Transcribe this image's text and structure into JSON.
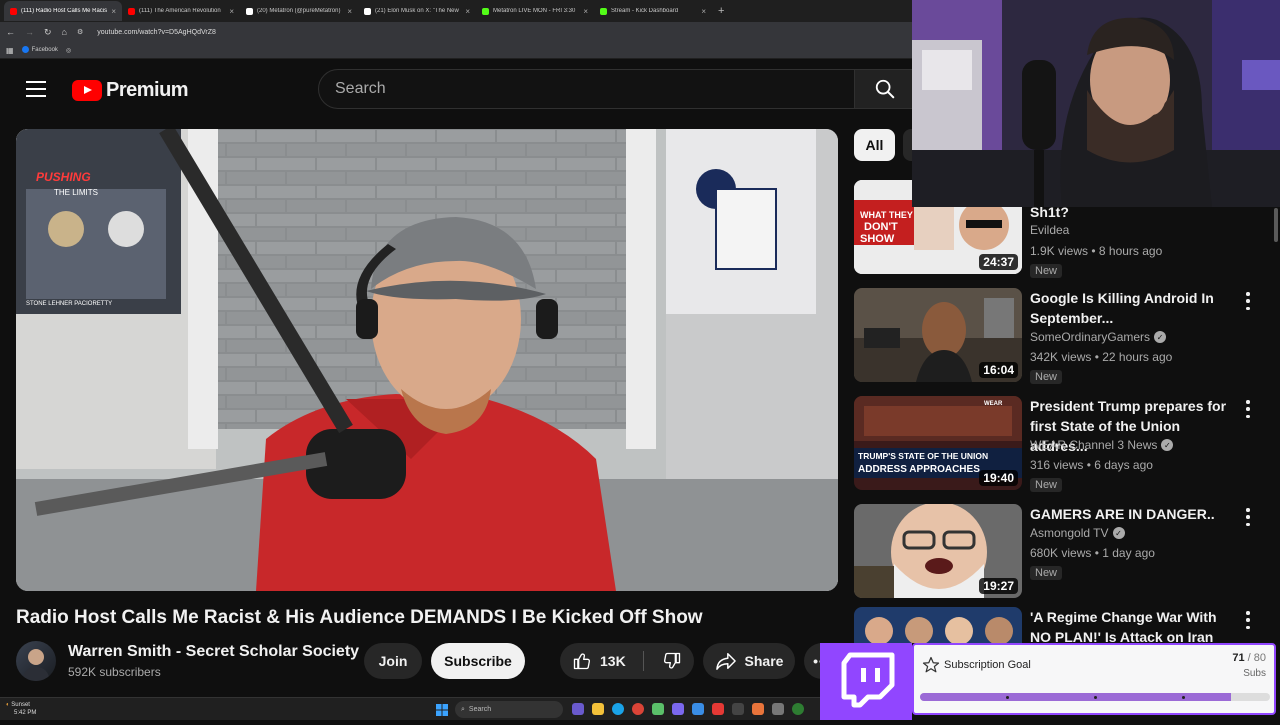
{
  "browser": {
    "tabs": [
      {
        "title": "(111) Radio Host Calls Me Racist",
        "color": "#ff0000",
        "active": true
      },
      {
        "title": "(111) The American Revolution",
        "color": "#ff0000",
        "active": false
      },
      {
        "title": "(20) Metatron (@pureMetatron)",
        "color": "#ffffff",
        "active": false
      },
      {
        "title": "(21) Elon Musk on X: \"The New",
        "color": "#ffffff",
        "active": false
      },
      {
        "title": "Metatron LIVE MON - FRI 3:30",
        "color": "#53fc18",
        "active": false
      },
      {
        "title": "Stream - Kick Dashboard",
        "color": "#53fc18",
        "active": false
      }
    ],
    "url": "youtube.com/watch?v=D5AgHQdVrZ8",
    "bookmarks": [
      "Facebook"
    ]
  },
  "header": {
    "logo_text": "Premium",
    "search_placeholder": "Search"
  },
  "video": {
    "title": "Radio Host Calls Me Racist & His Audience DEMANDS I Be Kicked Off Show",
    "channel": "Warren Smith - Secret Scholar Society",
    "subscribers": "592K subscribers",
    "join_label": "Join",
    "subscribe_label": "Subscribe",
    "likes": "13K",
    "share_label": "Share",
    "overlay_logo": "PUSHING THE LIMITS",
    "poster_names": "STONE   LEHNER   PACIORETTY"
  },
  "sidebar": {
    "chip_all": "All",
    "recommendations": [
      {
        "title": "Sh1t?",
        "channel": "Evildea",
        "verified": false,
        "meta": "1.9K views • 8 hours ago",
        "badge": "New",
        "duration": "24:37",
        "thumb_text": "WHAT THEY DON'T SHOW"
      },
      {
        "title": "Google Is Killing Android In September...",
        "channel": "SomeOrdinaryGamers",
        "verified": true,
        "meta": "342K views • 22 hours ago",
        "badge": "New",
        "duration": "16:04",
        "thumb_text": ""
      },
      {
        "title": "President Trump prepares for first State of the Union addres...",
        "channel": "WEAR Channel 3 News",
        "verified": true,
        "meta": "316 views • 6 days ago",
        "badge": "New",
        "duration": "19:40",
        "thumb_text": "TRUMP'S STATE OF THE UNION ADDRESS APPROACHES"
      },
      {
        "title": "GAMERS ARE IN DANGER..",
        "channel": "Asmongold TV",
        "verified": true,
        "meta": "680K views • 1 day ago",
        "badge": "New",
        "duration": "19:27",
        "thumb_text": ""
      },
      {
        "title": "'A Regime Change War With NO PLAN!' Is Attack on Iran Really...",
        "channel": "",
        "verified": false,
        "meta": "",
        "badge": "",
        "duration": "",
        "thumb_text": ""
      }
    ]
  },
  "sub_goal": {
    "label": "Subscription Goal",
    "current": "71",
    "total": "/ 80",
    "unit": "Subs",
    "progress": 0.8875
  },
  "taskbar": {
    "weather": "Sunset",
    "time": "5:42 PM",
    "search_label": "Search"
  },
  "colors": {
    "yt_red": "#ff0000",
    "twitch_purple": "#9146ff",
    "bg": "#0f0f0f"
  }
}
